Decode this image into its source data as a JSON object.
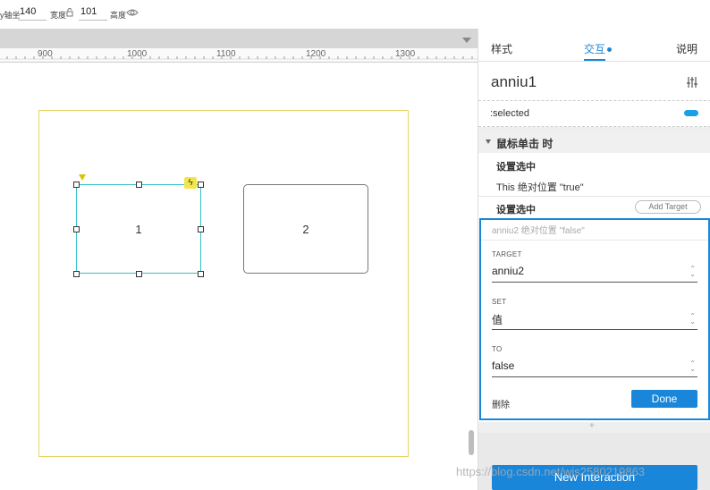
{
  "toolbar": {
    "y_label": "y轴坐",
    "y_value": "140",
    "width_label": "宽度",
    "width_value": "101",
    "height_label": "高度"
  },
  "ruler": {
    "labels": [
      "900",
      "1000",
      "1100",
      "1200",
      "1300"
    ]
  },
  "canvas": {
    "button1_text": "1",
    "button2_text": "2"
  },
  "panel": {
    "tabs": [
      "样式",
      "交互",
      "说明"
    ],
    "active_tab": "交互",
    "object_name": "anniu1",
    "selected_state_label": ":selected",
    "event_label": "鼠标单击 时",
    "action1_title": "设置选中",
    "action1_desc": "This 绝对位置 \"true\"",
    "action2_title": "设置选中",
    "add_target_label": "Add Target",
    "editor": {
      "preview": "anniu2 绝对位置 \"false\"",
      "target_label": "TARGET",
      "target_value": "anniu2",
      "set_label": "SET",
      "set_value": "值",
      "to_label": "TO",
      "to_value": "false",
      "delete_label": "删除",
      "done_label": "Done"
    },
    "plus_label": "+",
    "new_interaction_label": "New Interaction"
  },
  "watermark": "https://blog.csdn.net/wjs2580219863",
  "colors": {
    "accent": "#1a86d9",
    "selection": "#35c0c9",
    "artboard_border": "#e4d366",
    "lightning_badge": "#f3e64a"
  },
  "icons": [
    "lock-icon",
    "eye-icon",
    "lightning-icon",
    "tune-icon",
    "chevron-down-icon",
    "stepper-icon"
  ]
}
